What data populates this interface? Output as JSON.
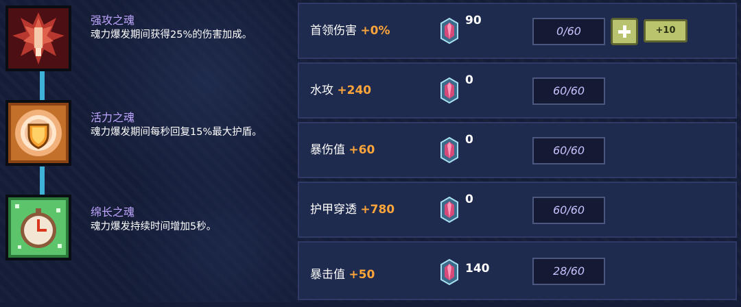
{
  "souls": [
    {
      "title": "强攻之魂",
      "description": "魂力爆发期间获得25%的伤害加成。",
      "icon": "red-dragon-icon"
    },
    {
      "title": "活力之魂",
      "description": "魂力爆发期间每秒回复15%最大护盾。",
      "icon": "golden-shield-icon"
    },
    {
      "title": "绵长之魂",
      "description": "魂力爆发持续时间增加5秒。",
      "icon": "green-clock-icon"
    }
  ],
  "stats": [
    {
      "label": "首领伤害",
      "bonus": "+0%",
      "crystals": "90",
      "progress": "0/60",
      "plus_label": "+10"
    },
    {
      "label": "水攻",
      "bonus": "+240",
      "crystals": "0",
      "progress": "60/60"
    },
    {
      "label": "暴伤值",
      "bonus": "+60",
      "crystals": "0",
      "progress": "60/60"
    },
    {
      "label": "护甲穿透",
      "bonus": "+780",
      "crystals": "0",
      "progress": "60/60"
    },
    {
      "label": "暴击值",
      "bonus": "+50",
      "crystals": "140",
      "progress": "28/60"
    }
  ],
  "colors": {
    "background": "#141c37",
    "row_background": "#1f2a4f",
    "soul_title": "#bfa6ff",
    "bonus": "#ffa53a",
    "progress_text": "#c9c2ff",
    "button": "#b9c26e",
    "connector": "#3fb2d8"
  }
}
